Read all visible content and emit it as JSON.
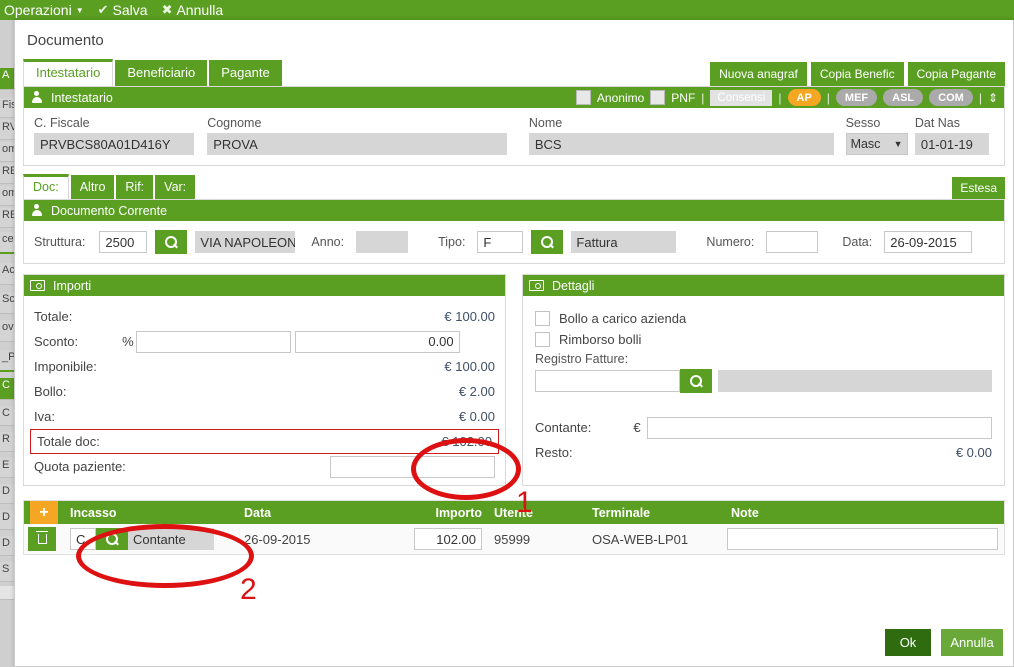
{
  "background": {
    "topbar": {
      "items": [
        {
          "label": "Operazioni",
          "icon": "caret-down-icon"
        },
        {
          "label": "Salva",
          "icon": "check-icon"
        },
        {
          "label": "Annulla",
          "icon": "x-icon"
        }
      ]
    },
    "left_strip": [
      "A",
      "Fis",
      "RV",
      "om",
      "RE",
      "om",
      "RE",
      "cet",
      "Ac",
      "Sch",
      "ove",
      "_P_",
      "C",
      "C",
      "R",
      "E",
      "D",
      "D",
      "D",
      "S"
    ]
  },
  "modal": {
    "title": "Documento",
    "tabs": [
      {
        "label": "Intestatario",
        "active": true
      },
      {
        "label": "Beneficiario",
        "active": false
      },
      {
        "label": "Pagante",
        "active": false
      }
    ],
    "tab_actions": [
      {
        "label": "Nuova anagraf"
      },
      {
        "label": "Copia Benefic"
      },
      {
        "label": "Copia Pagante"
      }
    ],
    "intestatario": {
      "panel_title": "Intestatario",
      "anonimo_label": "Anonimo",
      "pnf_label": "PNF",
      "consensi_label": "Consensi",
      "pills": [
        "AP",
        "MEF",
        "ASL",
        "COM"
      ],
      "separator": "|",
      "updown_icon": "up-down-arrows-icon",
      "fields": {
        "cf_label": "C. Fiscale",
        "cf_value": "PRVBCS80A01D416Y",
        "cognome_label": "Cognome",
        "cognome_value": "PROVA",
        "nome_label": "Nome",
        "nome_value": "BCS",
        "sesso_label": "Sesso",
        "sesso_value": "Masc",
        "datnas_label": "Dat Nas",
        "datnas_value": "01-01-19"
      }
    },
    "subtabs": [
      {
        "label": "Doc:",
        "active": true
      },
      {
        "label": "Altro",
        "active": false
      },
      {
        "label": "Rif:",
        "active": false
      },
      {
        "label": "Var:",
        "active": false
      }
    ],
    "estesa_label": "Estesa",
    "documento_corrente": {
      "panel_title": "Documento Corrente",
      "struttura_label": "Struttura:",
      "struttura_code": "2500",
      "struttura_desc": "VIA NAPOLEONA",
      "anno_label": "Anno:",
      "anno_value": "",
      "tipo_label": "Tipo:",
      "tipo_code": "F",
      "tipo_desc": "Fattura",
      "numero_label": "Numero:",
      "numero_value": "",
      "data_label": "Data:",
      "data_value": "26-09-2015",
      "search_icon": "magnifier-icon"
    },
    "importi": {
      "panel_title": "Importi",
      "icon": "money-icon",
      "rows": [
        {
          "label": "Totale:",
          "value": "€ 100.00",
          "type": "text"
        },
        {
          "label": "Sconto:",
          "value": "",
          "value2": "0.00",
          "pct": "%",
          "type": "input2"
        },
        {
          "label": "Imponibile:",
          "value": "€ 100.00",
          "type": "text"
        },
        {
          "label": "Bollo:",
          "value": "€ 2.00",
          "type": "text"
        },
        {
          "label": "Iva:",
          "value": "€ 0.00",
          "type": "text"
        },
        {
          "label": "Totale doc:",
          "value": "€ 102.00",
          "type": "text",
          "highlight": true
        },
        {
          "label": "Quota paziente:",
          "value": "",
          "type": "input"
        }
      ]
    },
    "dettagli": {
      "panel_title": "Dettagli",
      "icon": "money-icon",
      "checkboxes": [
        {
          "label": "Bollo a carico azienda",
          "checked": false
        },
        {
          "label": "Rimborso bolli",
          "checked": false
        }
      ],
      "registro_label": "Registro Fatture:",
      "registro_value": "",
      "registro_desc": "",
      "search_icon": "magnifier-icon",
      "contante_label": "Contante:",
      "contante_symbol": "€",
      "contante_value": "",
      "resto_label": "Resto:",
      "resto_value": "€ 0.00"
    },
    "incasso_table": {
      "add_label": "+",
      "delete_icon": "trash-icon",
      "search_icon": "magnifier-icon",
      "columns": [
        "Incasso",
        "Data",
        "Importo",
        "Utente",
        "Terminale",
        "Note"
      ],
      "rows": [
        {
          "incasso_code": "C",
          "incasso_desc": "Contante",
          "data": "26-09-2015",
          "importo": "102.00",
          "utente": "95999",
          "terminale": "OSA-WEB-LP01",
          "note": ""
        }
      ]
    },
    "footer": {
      "ok_label": "Ok",
      "cancel_label": "Annulla"
    }
  },
  "annotations": [
    {
      "number": "1",
      "target": "totale-doc-value"
    },
    {
      "number": "2",
      "target": "incasso-cell"
    }
  ],
  "colors": {
    "green": "#5a9e22",
    "dark_green": "#2f6b0f",
    "orange": "#f5a623",
    "annotation_red": "#dd1111",
    "gray_field": "#d6d6d6"
  }
}
